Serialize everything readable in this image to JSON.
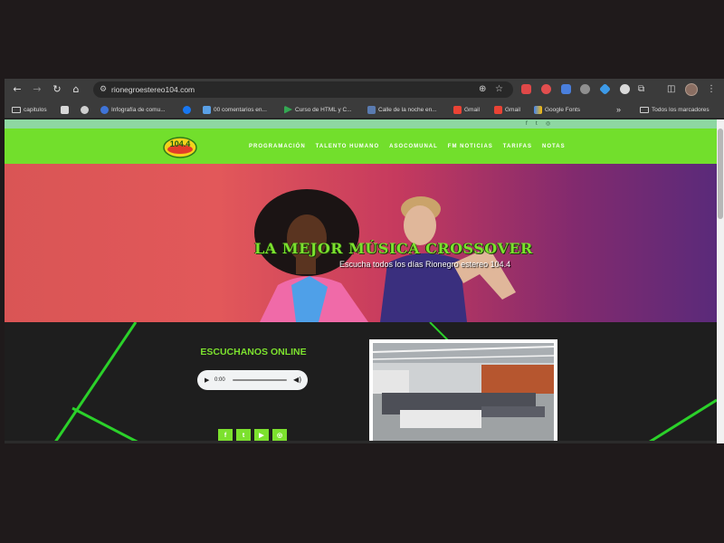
{
  "browser": {
    "url": "rionegroestereo104.com",
    "extensions": [
      "red-ext-icon",
      "red-badge-ext-icon",
      "translate-ext-icon",
      "gray-ext-icon",
      "blue-diamond-ext-icon",
      "white-circle-ext-icon",
      "puzzle-icon"
    ],
    "bookmarks": [
      {
        "label": "capitulos",
        "icon": "folder-icon"
      },
      {
        "label": "",
        "icon": "search-favicon"
      },
      {
        "label": "",
        "icon": "globe-favicon"
      },
      {
        "label": "Infografía de comu...",
        "icon": "infografia-favicon"
      },
      {
        "label": "",
        "icon": "facebook-favicon"
      },
      {
        "label": "00 comentarios en...",
        "icon": "comments-favicon"
      },
      {
        "label": "Curso de HTML y C...",
        "icon": "play-favicon"
      },
      {
        "label": "Calle de la noche en...",
        "icon": "image-favicon"
      },
      {
        "label": "Gmail",
        "icon": "gmail-favicon"
      },
      {
        "label": "Gmail",
        "icon": "gmail-favicon"
      },
      {
        "label": "Google Fonts",
        "icon": "google-fonts-favicon"
      }
    ],
    "all_bookmarks": "Todos los marcadores",
    "more_bookmarks": "»"
  },
  "site": {
    "menu": [
      "PROGRAMACIÓN",
      "TALENTO HUMANO",
      "ASOCOMUNAL",
      "FM NOTICIAS",
      "TARIFAS",
      "NOTAS"
    ],
    "logo_text": "104.4",
    "hero_title": "LA MEJOR MÚSICA CROSSOVER",
    "hero_subtitle": "Escucha todos los días Rionegro estereo 104.4",
    "listen_title": "ESCUCHANOS ONLINE",
    "player_time": "0:00",
    "social_top": [
      "f",
      "t",
      "◎"
    ],
    "social_buttons": [
      "f",
      "t",
      "▶",
      "◎"
    ]
  },
  "colors": {
    "brand_green": "#72df2c",
    "accent_green": "#7ce12e",
    "top_strip": "#8ed7a2"
  }
}
